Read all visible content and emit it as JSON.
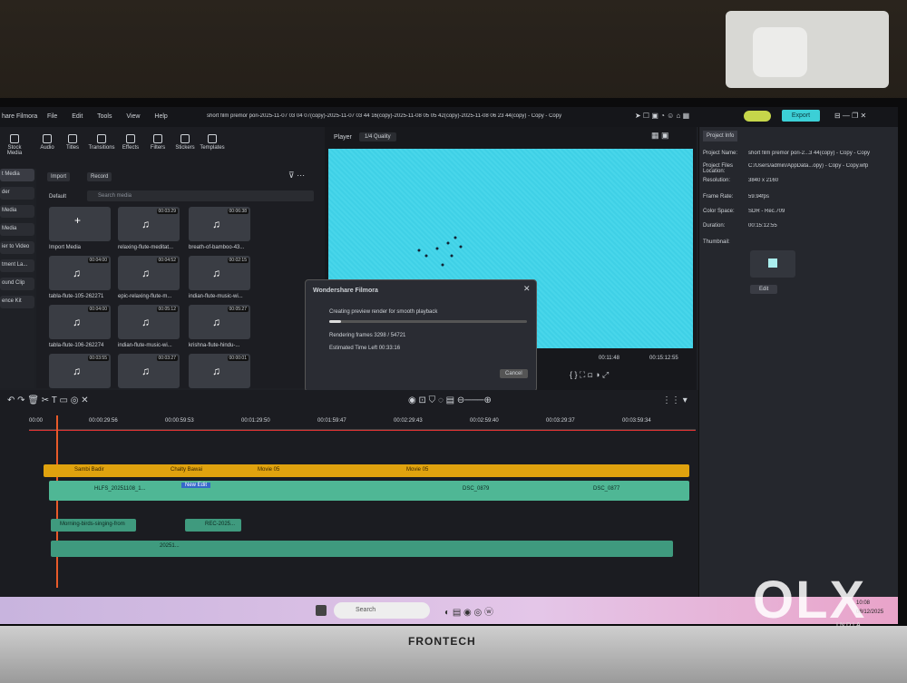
{
  "app": {
    "title_short": "hare Filmora",
    "project_title": "short film premor pori-2025-11-07 03 04 07(copy)-2025-11-07 03 44 16(copy)-2025-11-08 05 05 42(copy)-2025-11-08 06 23 44(copy) - Copy - Copy",
    "export_label": "Export"
  },
  "menu": [
    "File",
    "Edit",
    "Tools",
    "View",
    "Help"
  ],
  "toolbar": [
    "Stock Media",
    "Audio",
    "Titles",
    "Transitions",
    "Effects",
    "Filters",
    "Stickers",
    "Templates"
  ],
  "leftnav": [
    "t Media",
    "der",
    "Media",
    "Media",
    "ier to Video",
    "tment La...",
    "ound Clip",
    "ence Kit"
  ],
  "media": {
    "import_label": "Import",
    "record_label": "Record",
    "default_label": "Default",
    "search_placeholder": "Search media",
    "import_media": "Import Media",
    "items": [
      {
        "name": "relaxing-flute-meditat...",
        "dur": "00:03:29"
      },
      {
        "name": "breath-of-bamboo-43...",
        "dur": "00:06:38"
      },
      {
        "name": "tabla-flute-105-262271",
        "dur": "00:04:00"
      },
      {
        "name": "epic-relaxing-flute-m...",
        "dur": "00:04:52"
      },
      {
        "name": "indian-flute-music-wi...",
        "dur": "00:02:15"
      },
      {
        "name": "tabla-flute-106-262274",
        "dur": "00:04:00"
      },
      {
        "name": "indian-flute-music-wi...",
        "dur": "00:05:12"
      },
      {
        "name": "krishna-flute-hindu-...",
        "dur": "00:05:27"
      },
      {
        "name": "",
        "dur": "00:03:55"
      },
      {
        "name": "",
        "dur": "00:03:27"
      },
      {
        "name": "",
        "dur": "00:00:01"
      }
    ]
  },
  "player": {
    "label": "Player",
    "quality": "1/4 Quality",
    "current": "00:11:48",
    "total": "00:15:12:55"
  },
  "dialog": {
    "title": "Wondershare Filmora",
    "status": "Creating preview render for smooth playback",
    "frames": "Rendering frames 3298 / 54721",
    "eta": "Estimated Time Left 00:33:16",
    "cancel": "Cancel",
    "progress": 0.06
  },
  "info": {
    "tab": "Project Info",
    "rows": [
      {
        "k": "Project Name:",
        "v": "short film premor pori-2...3 44(copy) - Copy - Copy"
      },
      {
        "k": "Project Files Location:",
        "v": "C:/Users/admin/AppData...opy) - Copy - Copy.wfp"
      },
      {
        "k": "Resolution:",
        "v": "3840 x 2160"
      },
      {
        "k": "Frame Rate:",
        "v": "59.94fps"
      },
      {
        "k": "Color Space:",
        "v": "SDR - Rec.709"
      },
      {
        "k": "Duration:",
        "v": "00:15:12:55"
      },
      {
        "k": "Thumbnail:",
        "v": ""
      }
    ],
    "edit": "Edit"
  },
  "timeline": {
    "ticks": [
      "00:00",
      "00:00:29:56",
      "00:00:59:53",
      "00:01:29:50",
      "00:01:59:47",
      "00:02:29:43",
      "00:02:59:40",
      "00:03:29:37",
      "00:03:59:34"
    ],
    "titles": [
      "Sambi Badir",
      "Chalty Bawai",
      "Movie 05",
      "Movie 05"
    ],
    "clips": [
      "HLFS_20251108_1...",
      "New Edit",
      "DSC_0879",
      "DSC_0877"
    ],
    "audio": [
      "Morning-birds-singing-from",
      "REC-2025...",
      "20251..."
    ]
  },
  "taskbar": {
    "search": "Search",
    "time": "10:08",
    "date": "08/12/2025"
  },
  "monitor": {
    "brand": "FRONTECH"
  },
  "watermark": {
    "text": "OLX",
    "sub": "INDIA"
  }
}
